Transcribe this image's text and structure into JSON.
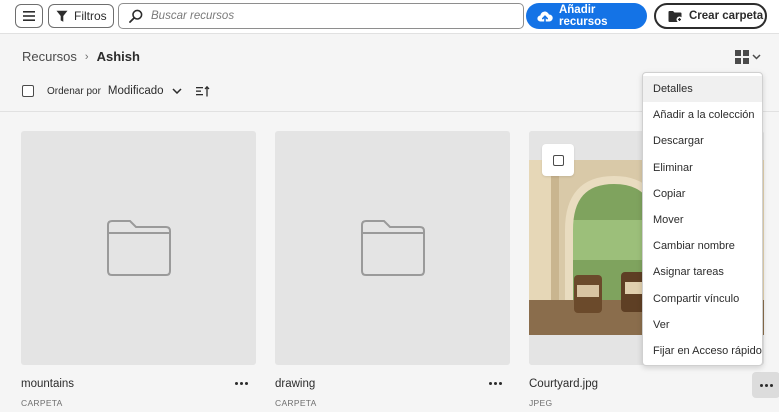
{
  "toolbar": {
    "menu_icon": "hamburger-menu-icon",
    "filters_label": "Filtros",
    "filter_icon": "funnel-icon",
    "search_placeholder": "Buscar recursos",
    "search_value": "",
    "search_icon": "magnifier-icon",
    "add_assets_label": "Añadir recursos",
    "add_assets_icon": "cloud-upload-icon",
    "create_folder_label": "Crear carpeta",
    "create_folder_icon": "folder-add-icon",
    "accent_color": "#1473e6"
  },
  "breadcrumb": {
    "parent": "Recursos",
    "separator": "›",
    "current": "Ashish"
  },
  "view_toggle_icon": "grid-view-icon",
  "sort": {
    "label": "Ordenar por",
    "value": "Modificado",
    "order_icon": "sort-order-icon"
  },
  "assets": [
    {
      "name": "mountains",
      "type": "CARPETA",
      "kind": "folder"
    },
    {
      "name": "drawing",
      "type": "CARPETA",
      "kind": "folder"
    },
    {
      "name": "Courtyard.jpg",
      "type": "JPEG",
      "kind": "image"
    }
  ],
  "context_menu": {
    "items": [
      "Detalles",
      "Añadir a la colección",
      "Descargar",
      "Eliminar",
      "Copiar",
      "Mover",
      "Cambiar nombre",
      "Asignar tareas",
      "Compartir vínculo",
      "Ver",
      "Fijar en Acceso rápido"
    ],
    "highlighted_index": 0
  }
}
